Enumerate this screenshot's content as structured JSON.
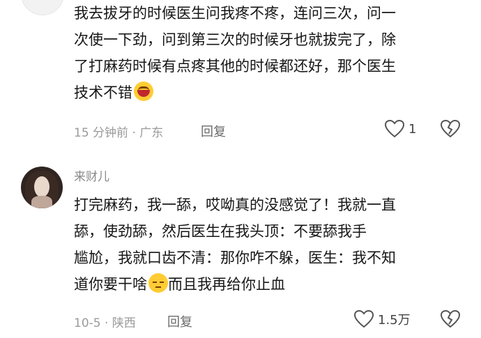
{
  "comments": [
    {
      "username": "",
      "lines": [
        "我去拔牙的时候医生问我疼不疼，连问三次，问一",
        "次使一下劲，问到第三次的时候牙也就拔完了，除",
        "了打麻药时候有点疼其他的时候都还好，那个医生",
        "技术不错"
      ],
      "emoji": "laughing-crying-icon",
      "meta": "15 分钟前 · 广东",
      "reply_label": "回复",
      "likes": "1"
    },
    {
      "username": "来财儿",
      "lines": [
        "打完麻药，我一舔，哎呦真的没感觉了！我就一直",
        "舔，使劲舔，然后医生在我头顶：不要舔我手",
        "尴尬，我就口齿不清：那你咋不躲，医生：我不知",
        "道你要干啥"
      ],
      "emoji": "sad-face-icon",
      "tail": "而且我再给你止血",
      "meta": "10-5 · 陕西",
      "reply_label": "回复",
      "likes": "1.5万"
    }
  ],
  "colors": {
    "text": "#161616",
    "meta": "#9a9a9a",
    "background": "#ffffff"
  }
}
